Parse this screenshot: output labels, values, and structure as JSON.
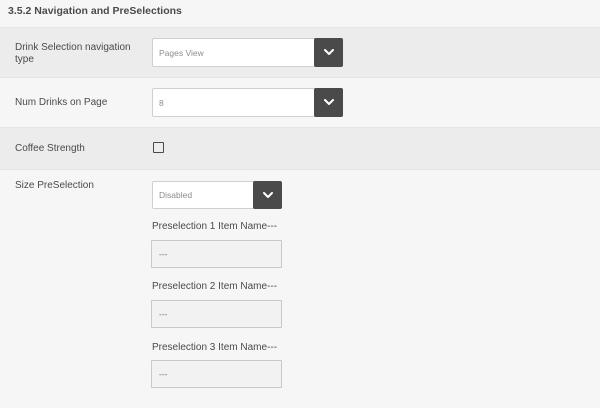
{
  "section": {
    "title": "3.5.2 Navigation and PreSelections"
  },
  "rows": {
    "drink_nav": {
      "label": "Drink Selection navigation type",
      "value": "Pages View"
    },
    "num_drinks": {
      "label": "Num Drinks on Page",
      "value": "8"
    },
    "coffee_strength": {
      "label": "Coffee Strength",
      "checked": false
    },
    "size_preselection": {
      "label": "Size PreSelection",
      "value": "Disabled"
    }
  },
  "preselections": [
    {
      "label": "Preselection 1 Item Name---",
      "value": "---"
    },
    {
      "label": "Preselection 2 Item Name---",
      "value": "---"
    },
    {
      "label": "Preselection 3 Item Name---",
      "value": "---"
    }
  ],
  "icons": {
    "dropdown": "chevron-down-icon"
  },
  "colors": {
    "background": "#f6f6f6",
    "shaded_row": "#ececec",
    "dropdown_button": "#4a4a4a"
  }
}
